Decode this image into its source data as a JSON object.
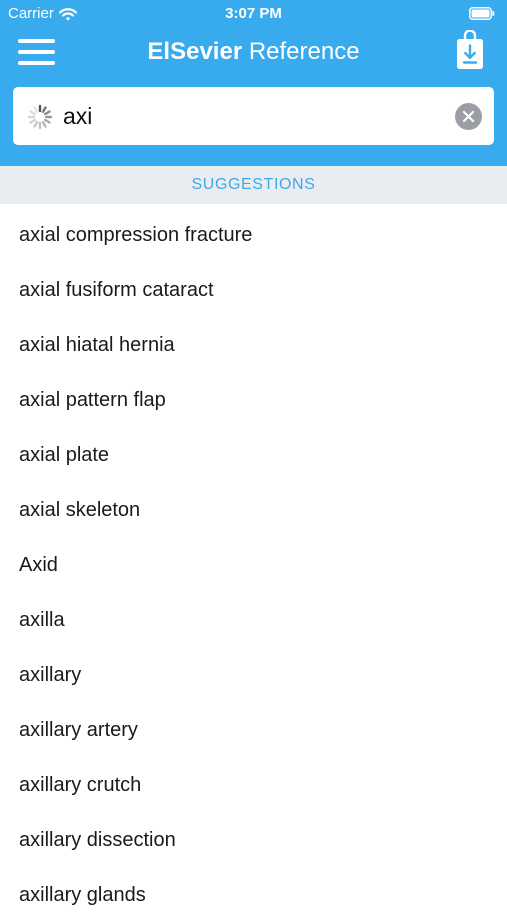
{
  "status_bar": {
    "carrier": "Carrier",
    "time": "3:07 PM",
    "wifi_icon": "wifi-icon",
    "battery_icon": "battery-icon"
  },
  "nav": {
    "title_brand": "ElSevier",
    "title_suffix": " Reference",
    "menu_icon": "hamburger-menu-icon",
    "download_icon": "download-bag-icon"
  },
  "search": {
    "value": "axi",
    "loading_icon": "spinner-icon",
    "clear_icon": "clear-icon"
  },
  "suggestions": {
    "header": "SUGGESTIONS",
    "items": [
      "axial compression fracture",
      "axial fusiform cataract",
      "axial hiatal hernia",
      "axial pattern flap",
      "axial plate",
      "axial skeleton",
      "Axid",
      "axilla",
      "axillary",
      "axillary artery",
      "axillary crutch",
      "axillary dissection",
      "axillary glands"
    ]
  },
  "colors": {
    "header_blue": "#38aaee",
    "section_header_bg": "#e9edf1",
    "section_header_text": "#3fa9e6",
    "clear_button_gray": "#9b9ea3",
    "caret_blue": "#2f80e0"
  }
}
